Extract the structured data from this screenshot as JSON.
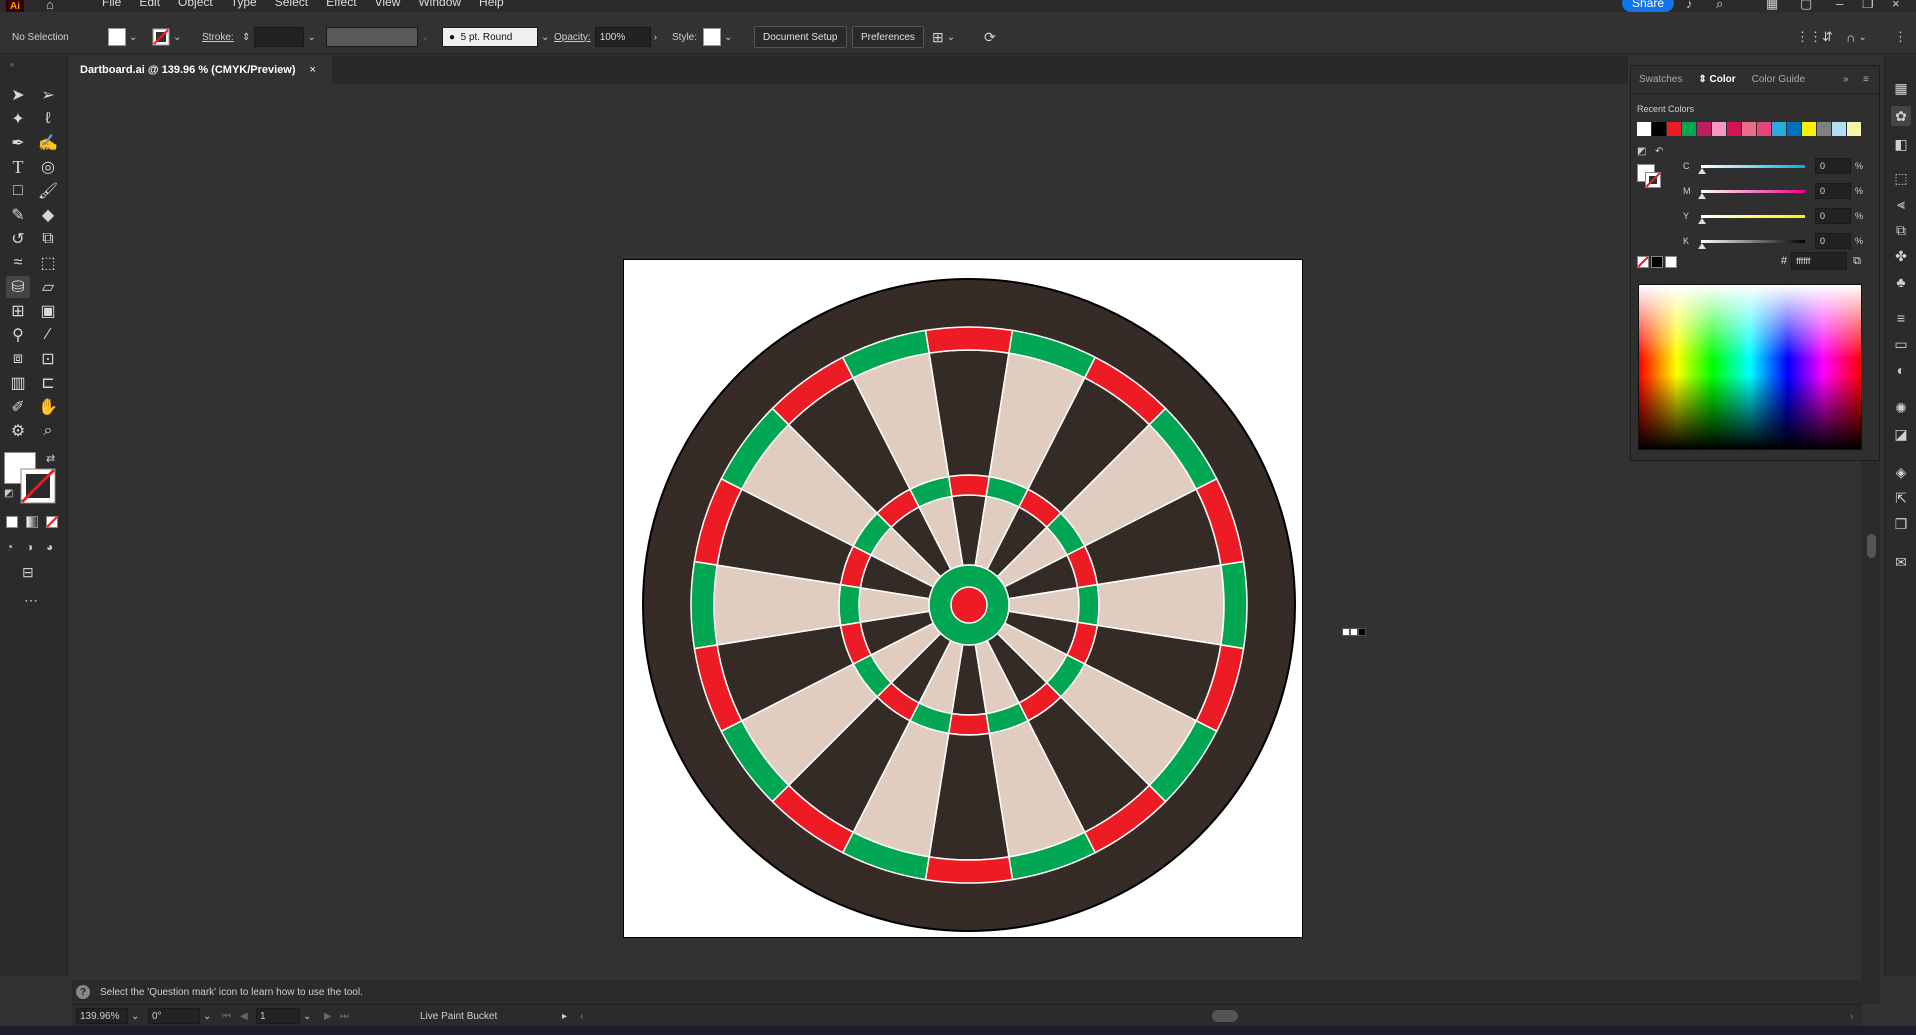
{
  "app": {
    "logo": "Ai",
    "home_icon": "home-icon"
  },
  "menu": [
    "File",
    "Edit",
    "Object",
    "Type",
    "Select",
    "Effect",
    "View",
    "Window",
    "Help"
  ],
  "topbar": {
    "share_label": "Share"
  },
  "control": {
    "selection": "No Selection",
    "stroke_label": "Stroke:",
    "brush": "5 pt. Round",
    "opacity_label": "Opacity:",
    "opacity_value": "100%",
    "style_label": "Style:",
    "doc_setup": "Document Setup",
    "preferences": "Preferences"
  },
  "tab": {
    "title": "Dartboard.ai @ 139.96 % (CMYK/Preview)",
    "close": "×"
  },
  "tools": [
    "selection-tool",
    "direct-selection-tool",
    "magic-wand-tool",
    "lasso-tool",
    "pen-tool",
    "curvature-tool",
    "type-tool",
    "spiral-tool",
    "rectangle-tool",
    "paintbrush-tool",
    "shaper-tool",
    "eraser-tool",
    "rotate-tool",
    "scale-tool",
    "warp-tool",
    "free-transform-tool",
    "live-paint-bucket-tool",
    "perspective-grid-tool",
    "mesh-tool",
    "gradient-tool",
    "eyedropper-tool",
    "blend-tool",
    "symbol-sprayer-tool",
    "slice-tool",
    "column-graph-tool",
    "artboard-tool",
    "pencil-tool",
    "hand-tool",
    "zoom-tool",
    "puppet-warp-tool"
  ],
  "panel": {
    "tabs": [
      "Swatches",
      "Color",
      "Color Guide"
    ],
    "recent_label": "Recent Colors",
    "recent_colors": [
      "#ffffff",
      "#000000",
      "#ed1c24",
      "#00a651",
      "#be1e5c",
      "#f49ac1",
      "#d4145a",
      "#ec6d8b",
      "#e6467a",
      "#29abe2",
      "#0071bc",
      "#fff200",
      "#808080",
      "#b3dcf5",
      "#f7f4a8"
    ],
    "channels": [
      {
        "letter": "C",
        "value": "0",
        "unit": "%",
        "gradient": "linear-gradient(to right,#fff,#00aeef)"
      },
      {
        "letter": "M",
        "value": "0",
        "unit": "%",
        "gradient": "linear-gradient(to right,#fff,#ec008c)"
      },
      {
        "letter": "Y",
        "value": "0",
        "unit": "%",
        "gradient": "linear-gradient(to right,#fff,#fff200)"
      },
      {
        "letter": "K",
        "value": "0",
        "unit": "%",
        "gradient": "linear-gradient(to right,#fff,#000)"
      }
    ],
    "hex_symbol": "#",
    "hex": "ffffff"
  },
  "hint": "Select the 'Question mark' icon to learn how to use the tool.",
  "status": {
    "zoom": "139.96%",
    "angle": "0°",
    "artboard": "1",
    "tool": "Live Paint Bucket"
  },
  "dartboard": {
    "colors": {
      "outer": "#362b27",
      "dark": "#342a26",
      "light": "#e0cdbf",
      "red": "#ed1c24",
      "green": "#00a651",
      "wire": "#ffffff"
    }
  }
}
